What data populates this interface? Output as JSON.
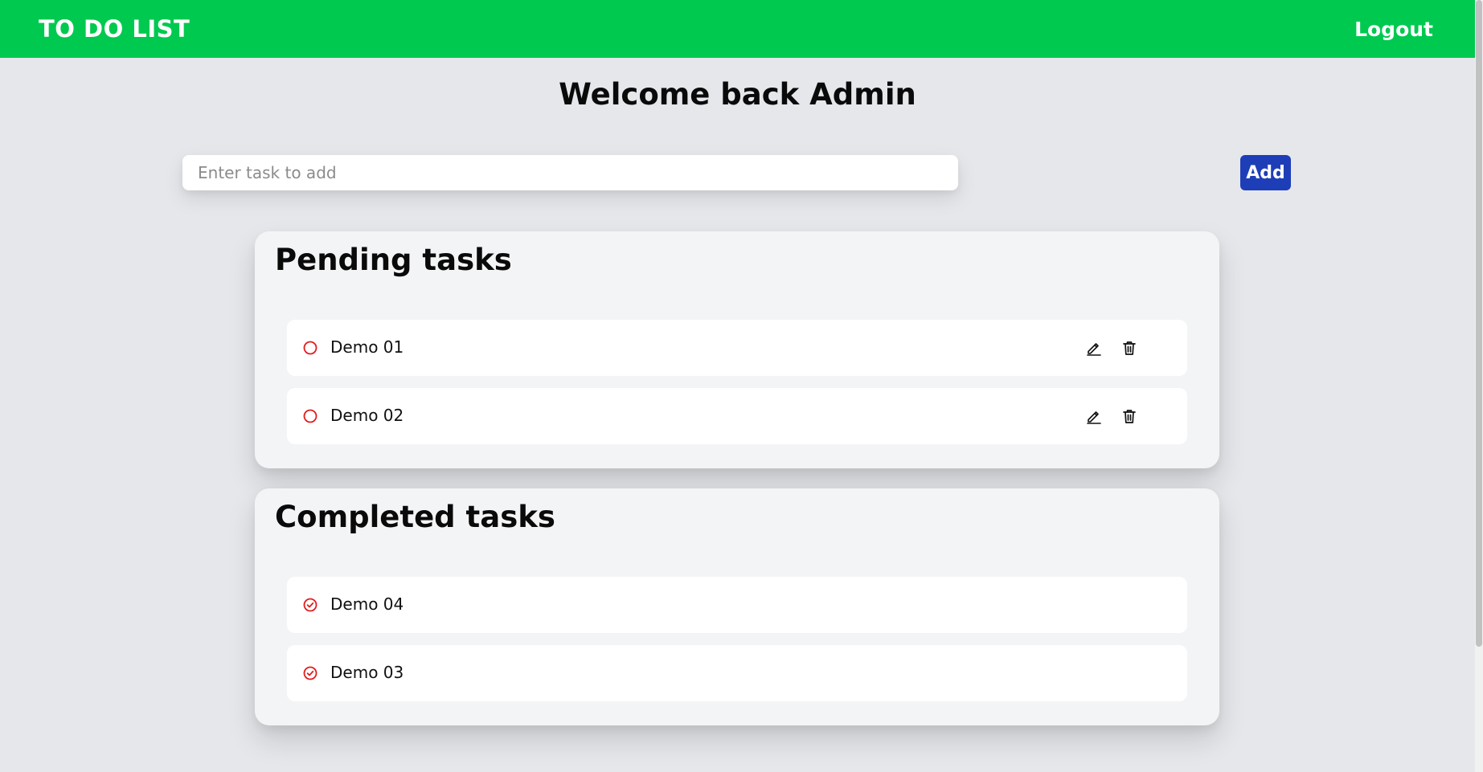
{
  "navbar": {
    "brand": "TO DO LIST",
    "logout_label": "Logout",
    "background_color": "#00c950"
  },
  "welcome": {
    "text": "Welcome back Admin"
  },
  "add_task": {
    "placeholder": "Enter task to add",
    "value": "",
    "button_label": "Add",
    "button_color": "#1e3eb8"
  },
  "pending": {
    "title": "Pending tasks",
    "status_icon": "circle-outline-icon",
    "status_color": "#e11d1d",
    "items": [
      {
        "label": "Demo 01",
        "actions": [
          "edit-icon",
          "trash-icon"
        ]
      },
      {
        "label": "Demo 02",
        "actions": [
          "edit-icon",
          "trash-icon"
        ]
      }
    ]
  },
  "completed": {
    "title": "Completed tasks",
    "status_icon": "circle-check-icon",
    "status_color": "#e11d1d",
    "items": [
      {
        "label": "Demo 04"
      },
      {
        "label": "Demo 03"
      }
    ]
  }
}
